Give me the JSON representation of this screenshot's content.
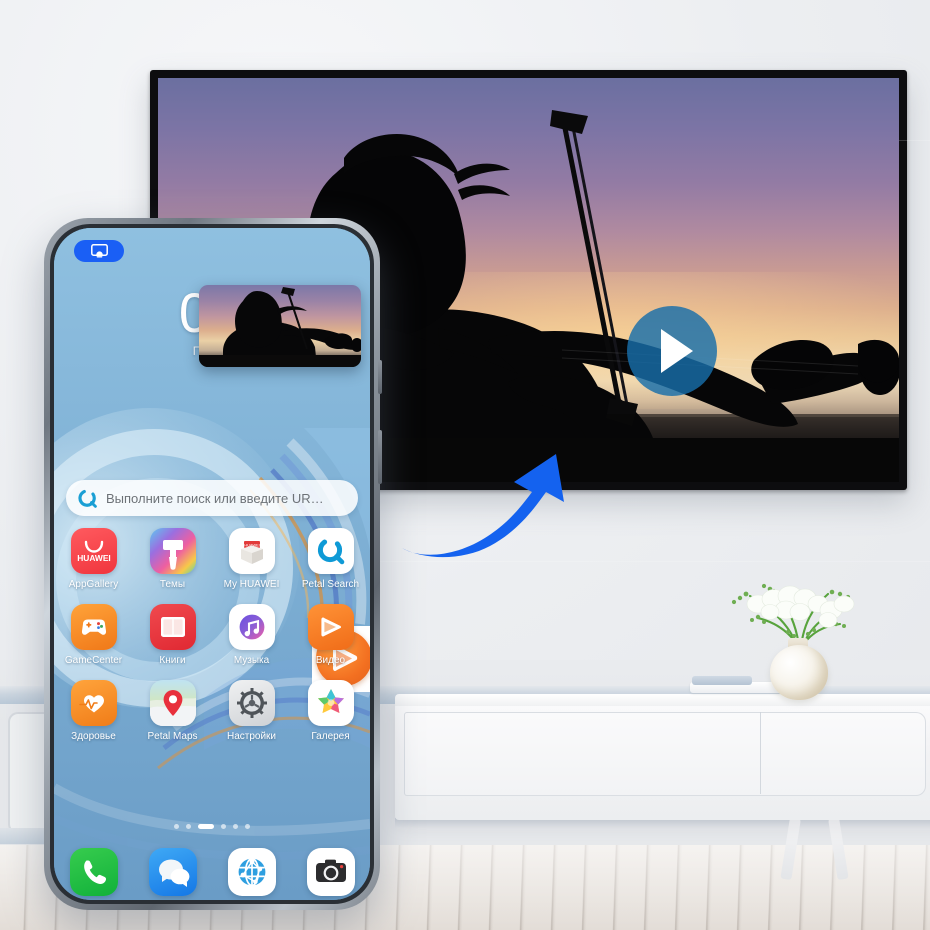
{
  "scene": {
    "title": "Huawei phone casting video to smart TV in living room",
    "wall_color": "#f1f2f4",
    "accent_blue": "#1a5ff5"
  },
  "tv": {
    "name": "smart-tv",
    "content_label": "violinist-silhouette-sunset",
    "play_button": "play-icon",
    "bezel_color": "#0d0d0f"
  },
  "arrow": {
    "label": "cast-direction-arrow",
    "color": "#1462ef"
  },
  "phone": {
    "cast_badge_icon": "cast-screen-icon",
    "status": {
      "time": "08",
      "date": "Пн, 8 а"
    },
    "video_thumbnail_label": "violinist-video-thumbnail",
    "drag_icon_label": "video-app-icon-dragging",
    "search": {
      "placeholder": "Выполните поиск или введите UR…",
      "icon": "petal-search-icon"
    },
    "grid": [
      [
        {
          "label": "AppGallery",
          "icon": "appgallery-icon"
        },
        {
          "label": "Темы",
          "icon": "themes-icon"
        },
        {
          "label": "My HUAWEI",
          "icon": "my-huawei-icon"
        },
        {
          "label": "Petal Search",
          "icon": "petal-search-icon"
        }
      ],
      [
        {
          "label": "GameCenter",
          "icon": "gamecenter-icon"
        },
        {
          "label": "Книги",
          "icon": "books-icon"
        },
        {
          "label": "Музыка",
          "icon": "music-icon"
        },
        {
          "label": "Видео",
          "icon": "video-icon"
        }
      ],
      [
        {
          "label": "Здоровье",
          "icon": "health-icon"
        },
        {
          "label": "Petal Maps",
          "icon": "petal-maps-icon"
        },
        {
          "label": "Настройки",
          "icon": "settings-icon"
        },
        {
          "label": "Галерея",
          "icon": "gallery-icon"
        }
      ]
    ],
    "page_dots": {
      "count": 6,
      "active_index": 2
    },
    "dock": [
      {
        "label": "phone-app",
        "icon": "phone-icon"
      },
      {
        "label": "messages-app",
        "icon": "message-bubble-icon"
      },
      {
        "label": "browser-app",
        "icon": "globe-icon"
      },
      {
        "label": "camera-app",
        "icon": "camera-icon"
      }
    ]
  },
  "room": {
    "console_label": "tv-console",
    "vase_label": "orchid-vase",
    "books_label": "stacked-books"
  }
}
